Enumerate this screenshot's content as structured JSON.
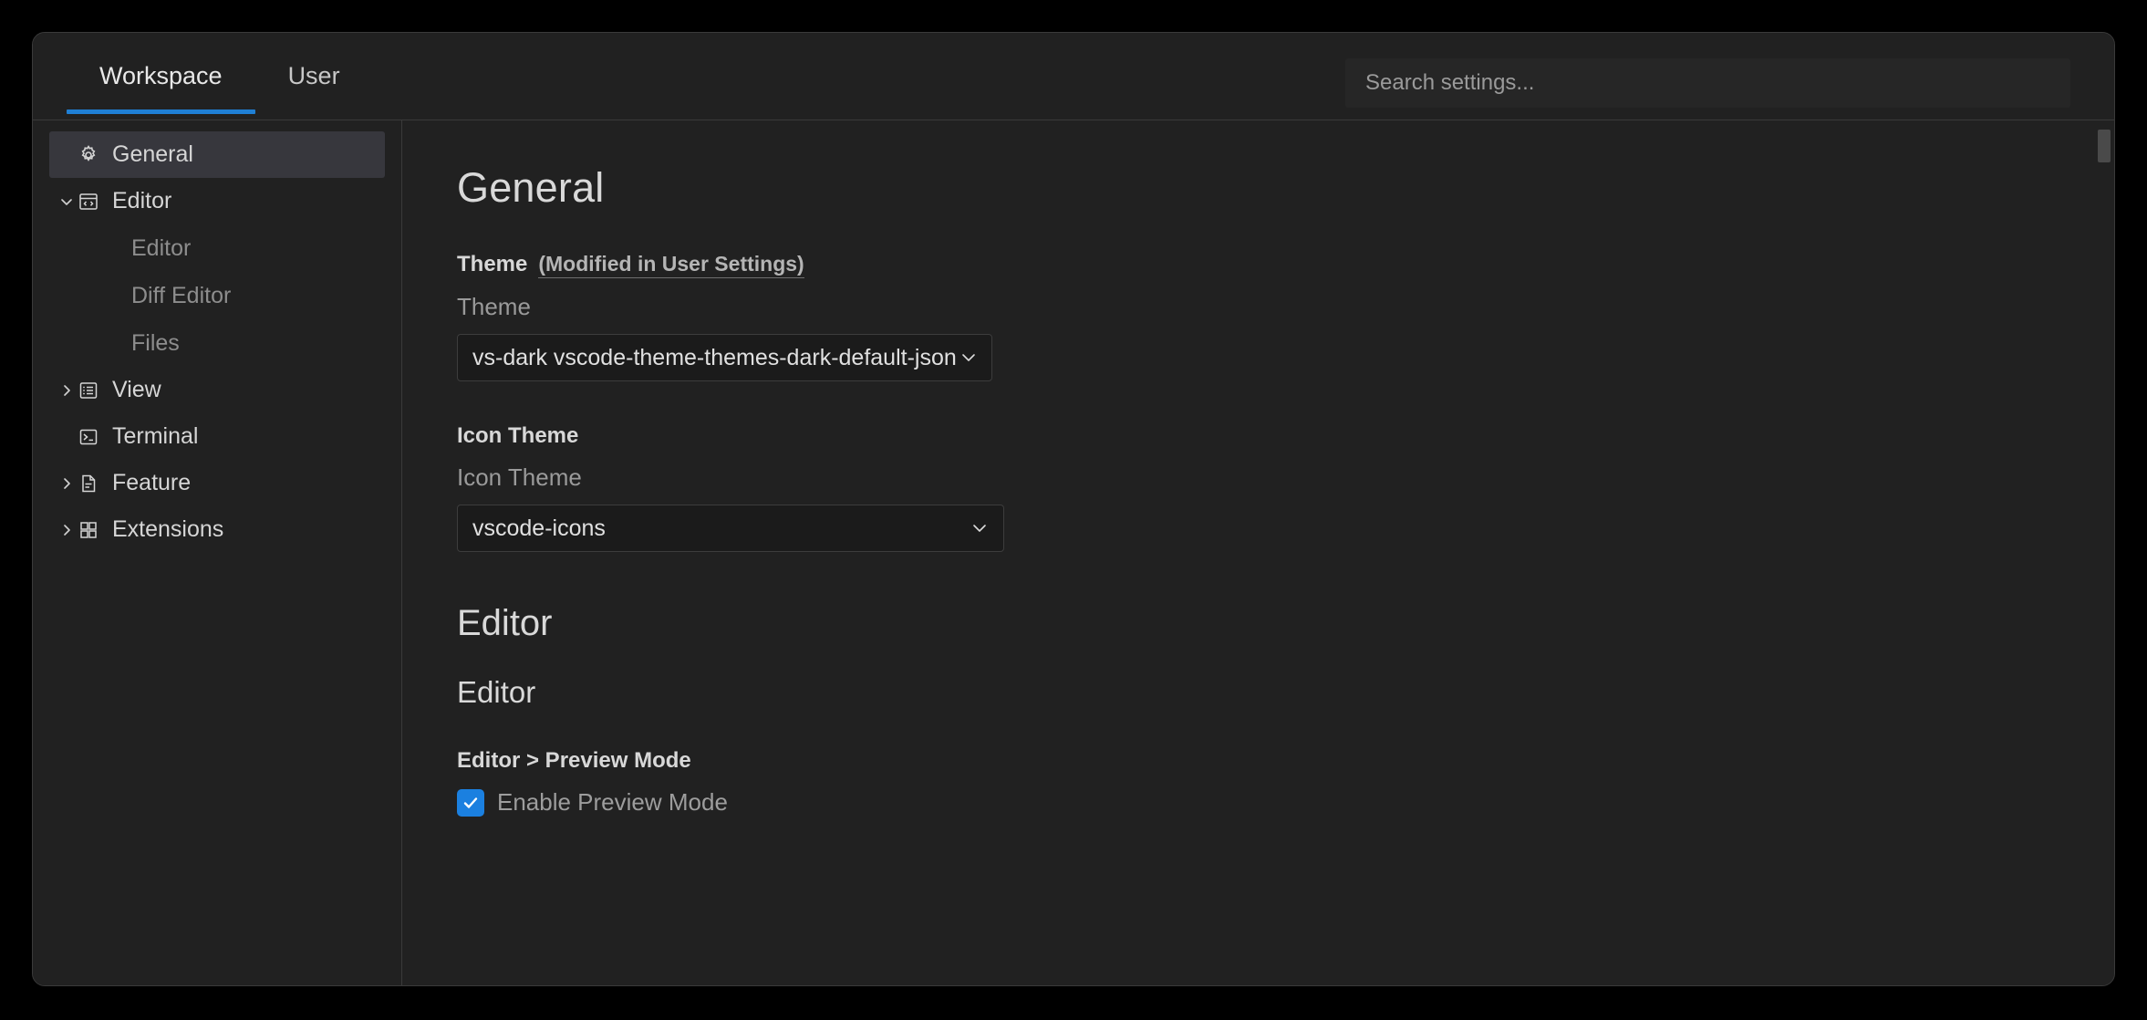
{
  "window": {
    "accent_color": "#1f7fd4",
    "background": "#212121",
    "border_color": "#3a3a3a"
  },
  "header": {
    "tabs": [
      {
        "label": "Workspace",
        "active": true
      },
      {
        "label": "User",
        "active": false
      }
    ],
    "search": {
      "placeholder": "Search settings...",
      "value": ""
    }
  },
  "sidebar": {
    "items": [
      {
        "label": "General",
        "icon": "gear-icon",
        "twisty": "none",
        "selected": true,
        "child": false
      },
      {
        "label": "Editor",
        "icon": "code-window-icon",
        "twisty": "down",
        "selected": false,
        "child": false
      },
      {
        "label": "Editor",
        "icon": "none",
        "twisty": "none",
        "selected": false,
        "child": true
      },
      {
        "label": "Diff Editor",
        "icon": "none",
        "twisty": "none",
        "selected": false,
        "child": true
      },
      {
        "label": "Files",
        "icon": "none",
        "twisty": "none",
        "selected": false,
        "child": true
      },
      {
        "label": "View",
        "icon": "list-icon",
        "twisty": "right",
        "selected": false,
        "child": false
      },
      {
        "label": "Terminal",
        "icon": "terminal-icon",
        "twisty": "none",
        "selected": false,
        "child": false
      },
      {
        "label": "Feature",
        "icon": "file-icon",
        "twisty": "right",
        "selected": false,
        "child": false
      },
      {
        "label": "Extensions",
        "icon": "grid-icon",
        "twisty": "right",
        "selected": false,
        "child": false
      }
    ]
  },
  "main": {
    "page_title": "General",
    "theme_setting": {
      "title": "Theme",
      "modified_note": "(Modified in User Settings)",
      "label": "Theme",
      "value": "vs-dark vscode-theme-themes-dark-default-json"
    },
    "icon_theme_setting": {
      "title": "Icon Theme",
      "label": "Icon Theme",
      "value": "vscode-icons"
    },
    "editor_section": {
      "heading": "Editor",
      "subheading": "Editor",
      "preview_mode": {
        "title": "Editor > Preview Mode",
        "checkbox_label": "Enable Preview Mode",
        "checked": true,
        "checkbox_color": "#1b80e0"
      }
    }
  }
}
